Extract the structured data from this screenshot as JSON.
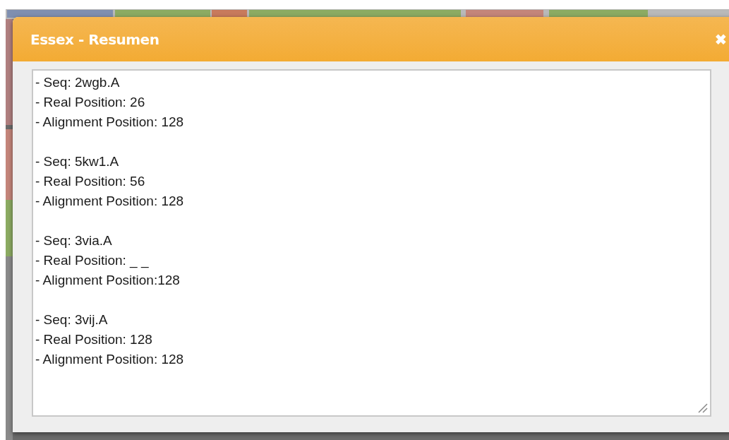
{
  "dialog": {
    "title": "Essex - Resumen",
    "close_icon": "✖"
  },
  "summary_blocks": [
    [
      "- Seq: 2wgb.A",
      "- Real Position: 26",
      "- Alignment Position: 128"
    ],
    [
      "- Seq: 5kw1.A",
      "- Real Position: 56",
      "- Alignment Position: 128"
    ],
    [
      "- Seq: 3via.A",
      "- Real Position: _ _",
      "- Alignment Position:128"
    ],
    [
      "- Seq: 3vij.A",
      "- Real Position: 128",
      "- Alignment Position: 128"
    ]
  ]
}
